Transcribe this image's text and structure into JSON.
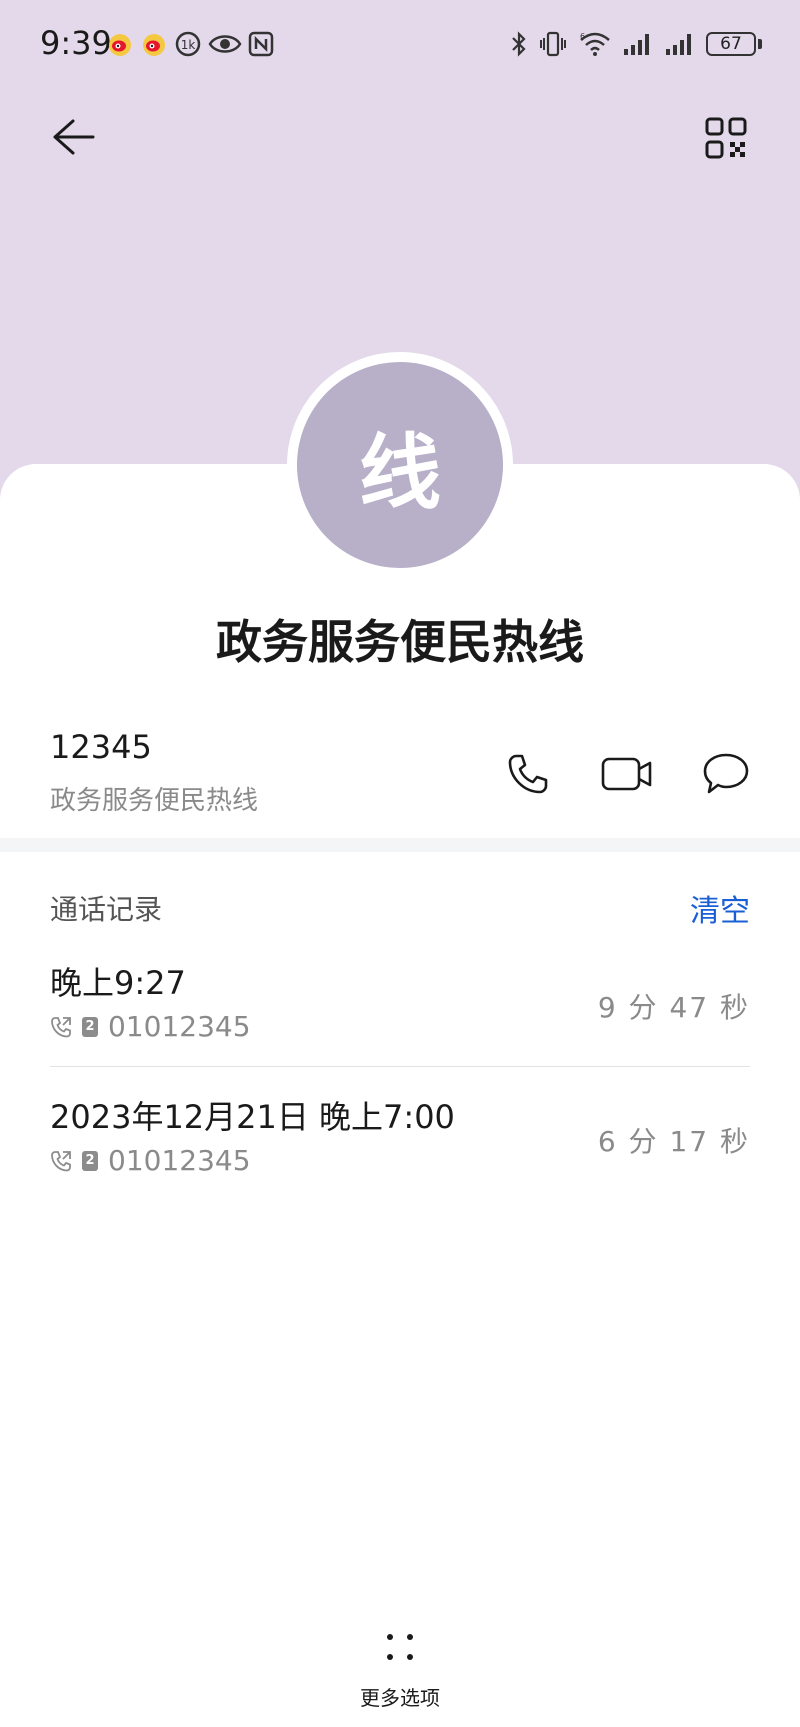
{
  "status_bar": {
    "time": "9:39",
    "battery": "67",
    "left_icons": [
      "weibo-icon",
      "weibo-icon",
      "data-saver-icon",
      "eye-icon",
      "nfc-icon"
    ],
    "right_icons": [
      "bluetooth-icon",
      "vibrate-icon",
      "wifi-icon",
      "signal-icon",
      "signal-icon",
      "battery-icon"
    ]
  },
  "top_bar": {
    "back_icon": "arrow-left-icon",
    "qr_icon": "qr-code-icon"
  },
  "contact": {
    "avatar_letter": "线",
    "name": "政务服务便民热线",
    "number": "12345",
    "number_label": "政务服务便民热线"
  },
  "actions": {
    "call_icon": "phone-icon",
    "video_icon": "video-call-icon",
    "message_icon": "message-icon"
  },
  "call_log": {
    "title": "通话记录",
    "clear_label": "清空",
    "items": [
      {
        "time": "晚上9:27",
        "sim": "2",
        "number": "01012345",
        "duration": "9 分 47 秒"
      },
      {
        "time": "2023年12月21日 晚上7:00",
        "sim": "2",
        "number": "01012345",
        "duration": "6 分 17 秒"
      }
    ]
  },
  "bottom": {
    "more_label": "更多选项"
  },
  "colors": {
    "header_bg": "#e3d9ea",
    "avatar_bg": "#b8afc9",
    "accent": "#1a5fd6"
  }
}
